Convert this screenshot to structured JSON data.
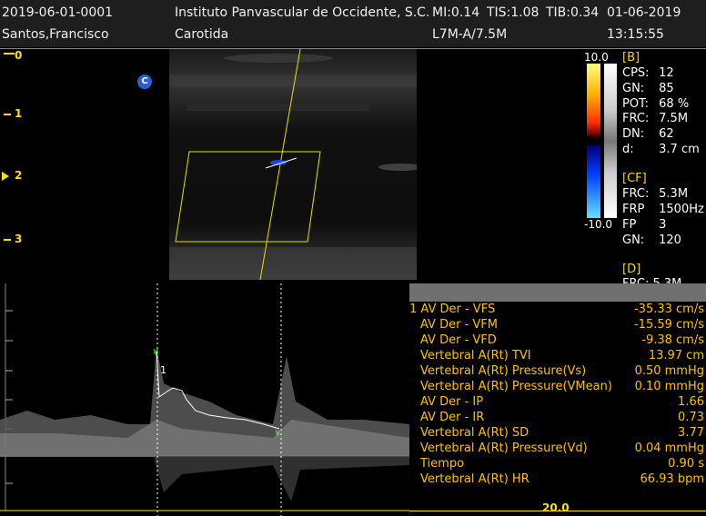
{
  "header": {
    "patient_id": "2019-06-01-0001",
    "institution": "Instituto Panvascular de Occidente, S.C.",
    "mi": "MI:0.14",
    "tis": "TIS:1.08",
    "tib": "TIB:0.34",
    "date": "01-06-2019",
    "patient_name": "Santos,Francisco",
    "exam": "Carotida",
    "probe": "L7M-A/7.5M",
    "time": "13:15:55"
  },
  "depth_scale": {
    "labels": [
      "0",
      "1",
      "2",
      "3"
    ]
  },
  "marker_c": "C",
  "color_bar": {
    "max": "10.0",
    "min": "-10.0"
  },
  "b_mode": {
    "title": "[B]",
    "params": [
      {
        "key": "CPS:",
        "value": "12"
      },
      {
        "key": "GN:",
        "value": "85"
      },
      {
        "key": "POT:",
        "value": "68 %"
      },
      {
        "key": "FRC:",
        "value": "7.5M"
      },
      {
        "key": "DN:",
        "value": "62"
      },
      {
        "key": "d:",
        "value": "3.7 cm"
      }
    ]
  },
  "cf_mode": {
    "title": "[CF]",
    "params": [
      {
        "key": "FRC:",
        "value": "5.3M"
      },
      {
        "key": "FRP",
        "value": "1500Hz"
      },
      {
        "key": "FP",
        "value": "3"
      },
      {
        "key": "GN:",
        "value": "120"
      }
    ]
  },
  "d_mode": {
    "title": "[D]",
    "partial": "FRC: 5.3M"
  },
  "doppler": {
    "cursor_label": "1",
    "bottom_scale": "20.0"
  },
  "measurements": [
    {
      "label": "1 AV Der - VFS",
      "value": "-35.33 cm/s"
    },
    {
      "label": "AV Der - VFM",
      "value": "-15.59 cm/s"
    },
    {
      "label": "AV Der - VFD",
      "value": "-9.38 cm/s"
    },
    {
      "label": "Vertebral A(Rt) TVI",
      "value": "13.97 cm"
    },
    {
      "label": "Vertebral A(Rt) Pressure(Vs)",
      "value": "0.50 mmHg"
    },
    {
      "label": "Vertebral A(Rt) Pressure(VMean)",
      "value": "0.10 mmHg"
    },
    {
      "label": "AV Der - IP",
      "value": "1.66"
    },
    {
      "label": "AV Der - IR",
      "value": "0.73"
    },
    {
      "label": "Vertebral A(Rt) SD",
      "value": "3.77"
    },
    {
      "label": "Vertebral A(Rt) Pressure(Vd)",
      "value": "0.04 mmHg"
    },
    {
      "label": "Tiempo",
      "value": "0.90 s"
    },
    {
      "label": "Vertebral A(Rt) HR",
      "value": "66.93 bpm"
    }
  ],
  "colors": {
    "accent_yellow": "#ffe000",
    "measure_text": "#ffc000",
    "header_bg": "#1e1e1e"
  }
}
